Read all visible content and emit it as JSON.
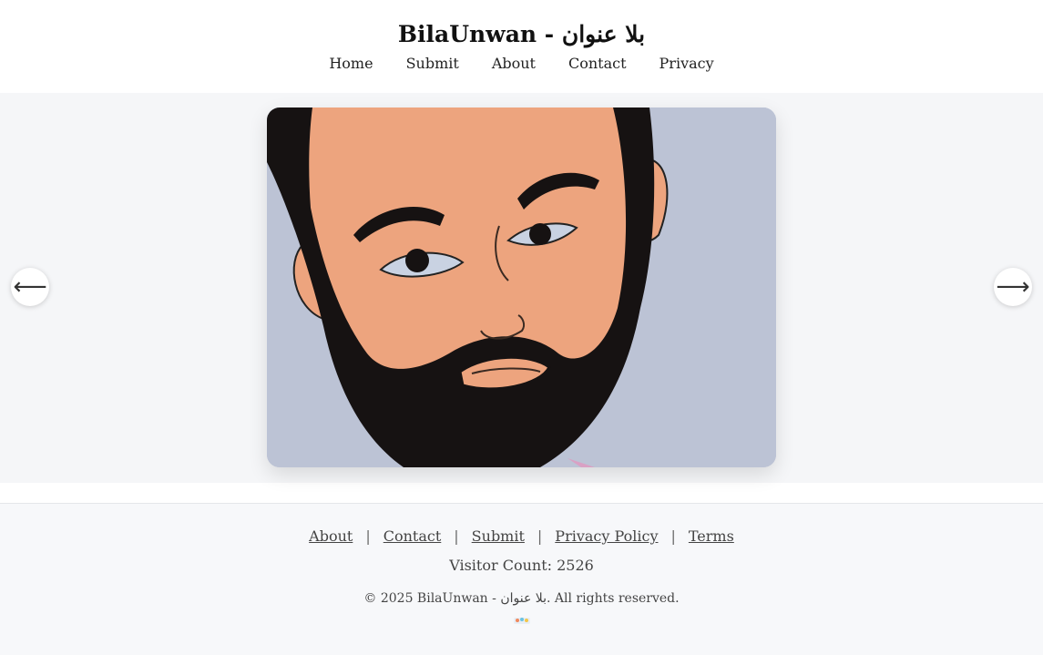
{
  "header": {
    "title": "BilaUnwan - بلا عنوان",
    "nav": [
      "Home",
      "Submit",
      "About",
      "Contact",
      "Privacy"
    ]
  },
  "slider": {
    "prev_icon": "arrow-left-icon",
    "next_icon": "arrow-right-icon",
    "prev_glyph": "⟵",
    "next_glyph": "⟶"
  },
  "footer": {
    "links": {
      "about": "About",
      "contact": "Contact",
      "submit": "Submit",
      "privacy": "Privacy Policy",
      "terms": "Terms"
    },
    "separator": "|",
    "visitor_count": "Visitor Count: 2526",
    "copyright": "© 2025 BilaUnwan - بلا عنوان. All rights reserved."
  },
  "colors": {
    "page_bg": "#f7f8fa",
    "header_bg": "#ffffff",
    "slide_bg": "#b9c1d4",
    "skin": "#eda47e",
    "hair": "#161212"
  }
}
